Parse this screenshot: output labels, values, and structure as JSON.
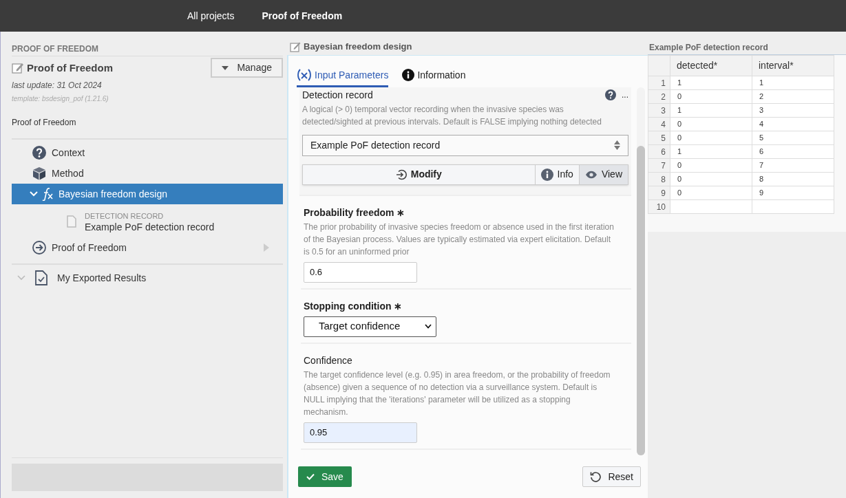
{
  "nav": [
    {
      "label": "All projects",
      "selected": false
    },
    {
      "label": "Proof of Freedom",
      "selected": true
    }
  ],
  "sidebar": {
    "section_title": "PROOF OF FREEDOM",
    "project_title": "Proof of Freedom",
    "manage_button": "Manage",
    "last_update": "last update: 31 Oct 2024",
    "template": "template: bsdesign_pof (1.21.6)",
    "description": "Proof of Freedom",
    "tree": [
      {
        "kind": "question",
        "label": "Context",
        "selected": false
      },
      {
        "kind": "cube",
        "label": "Method",
        "selected": false
      },
      {
        "kind": "function",
        "label": "Bayesian freedom design",
        "selected": true,
        "expanded": true,
        "children": [
          {
            "kind": "file",
            "caption": "DETECTION RECORD",
            "label": "Example PoF detection record"
          }
        ]
      },
      {
        "kind": "arrow",
        "label": "Proof of Freedom",
        "selected": false
      }
    ],
    "results": {
      "label": "My Exported Results",
      "expanded": true
    }
  },
  "editor": {
    "title": "Bayesian freedom design",
    "tabs": [
      {
        "kind": "variable",
        "label": "Input Parameters",
        "selected": true
      },
      {
        "kind": "info",
        "label": "Information",
        "selected": false
      }
    ],
    "fields": [
      {
        "kind": "dataset",
        "label": "Detection record",
        "bold": false,
        "description": "A logical (> 0) temporal vector recording when the invasive species was detected/sighted at previous intervals. Default is FALSE implying nothing detected",
        "more": "...",
        "value": "Example PoF detection record",
        "buttons": [
          {
            "kind": "modify",
            "label": "Modify",
            "selected": false
          },
          {
            "kind": "info",
            "label": "Info",
            "selected": false
          },
          {
            "kind": "view",
            "label": "View",
            "selected": true
          }
        ]
      },
      {
        "kind": "number",
        "label": "Probability freedom ∗",
        "bold": true,
        "description": "The prior probability of invasive species freedom or absence used in the first iteration of the Bayesian process. Values are typically estimated via expert elicitation. Default is 0.5 for an uninformed prior",
        "value": "0.6",
        "highlighted": false
      },
      {
        "kind": "select",
        "label": "Stopping condition ∗",
        "bold": true,
        "value": "Target confidence"
      },
      {
        "kind": "number",
        "label": "Confidence",
        "bold": false,
        "description": "The target confidence level (e.g. 0.95) in area freedom, or the probability of freedom (absence) given a sequence of no detection via a surveillance system. Default is NULL implying that the 'iterations' parameter will be utilized as a stopping mechanism.",
        "value": "0.95",
        "highlighted": true
      }
    ],
    "save_button": "Save",
    "reset_button": "Reset"
  },
  "table": {
    "title": "Example PoF detection record",
    "columns": [
      "detected*",
      "interval*"
    ],
    "rows": [
      {
        "index": "1",
        "cells": [
          "1",
          "1"
        ]
      },
      {
        "index": "2",
        "cells": [
          "0",
          "2"
        ]
      },
      {
        "index": "3",
        "cells": [
          "1",
          "3"
        ]
      },
      {
        "index": "4",
        "cells": [
          "0",
          "4"
        ]
      },
      {
        "index": "5",
        "cells": [
          "0",
          "5"
        ]
      },
      {
        "index": "6",
        "cells": [
          "1",
          "6"
        ]
      },
      {
        "index": "7",
        "cells": [
          "0",
          "7"
        ]
      },
      {
        "index": "8",
        "cells": [
          "0",
          "8"
        ]
      },
      {
        "index": "9",
        "cells": [
          "0",
          "9"
        ]
      },
      {
        "index": "10",
        "cells": [
          "",
          ""
        ]
      }
    ]
  }
}
